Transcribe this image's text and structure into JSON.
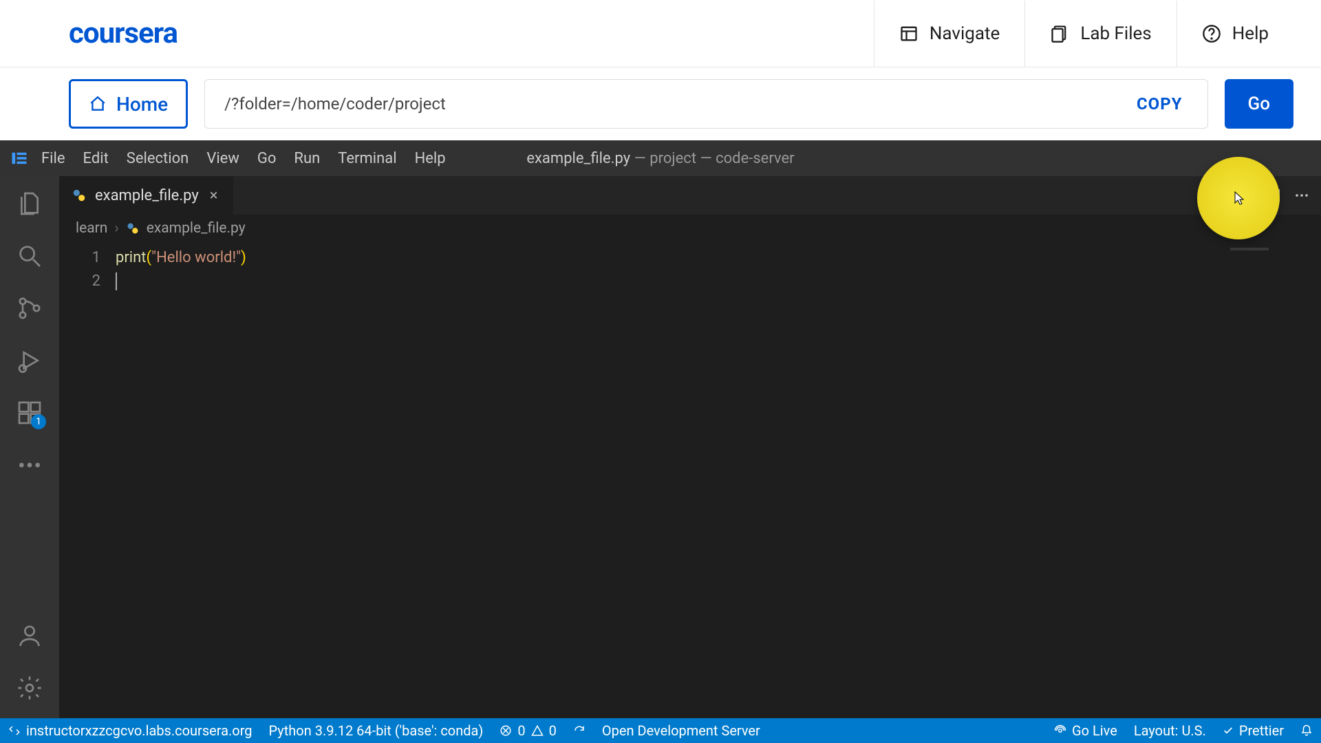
{
  "coursera": {
    "logo": "coursera",
    "nav": {
      "navigate": "Navigate",
      "labfiles": "Lab Files",
      "help": "Help"
    },
    "home": "Home",
    "url": "/?folder=/home/coder/project",
    "copy": "COPY",
    "go": "Go"
  },
  "vscode": {
    "menus": [
      "File",
      "Edit",
      "Selection",
      "View",
      "Go",
      "Run",
      "Terminal",
      "Help"
    ],
    "window_title_file": "example_file.py",
    "window_title_rest": " — project — code-server",
    "tab": {
      "name": "example_file.py"
    },
    "breadcrumb": {
      "root": "learn",
      "file": "example_file.py"
    },
    "code": {
      "line_numbers": [
        "1",
        "2"
      ],
      "l1_fn": "print",
      "l1_p_open": "(",
      "l1_str": "\"Hello world!\"",
      "l1_p_close": ")"
    },
    "activity_badge": "1",
    "status": {
      "remote": "instructorxzzcgcvo.labs.coursera.org",
      "python": "Python 3.9.12 64-bit ('base': conda)",
      "errors": "0",
      "warnings": "0",
      "open_dev": "Open Development Server",
      "golive": "Go Live",
      "layout": "Layout: U.S.",
      "prettier": "Prettier"
    }
  }
}
